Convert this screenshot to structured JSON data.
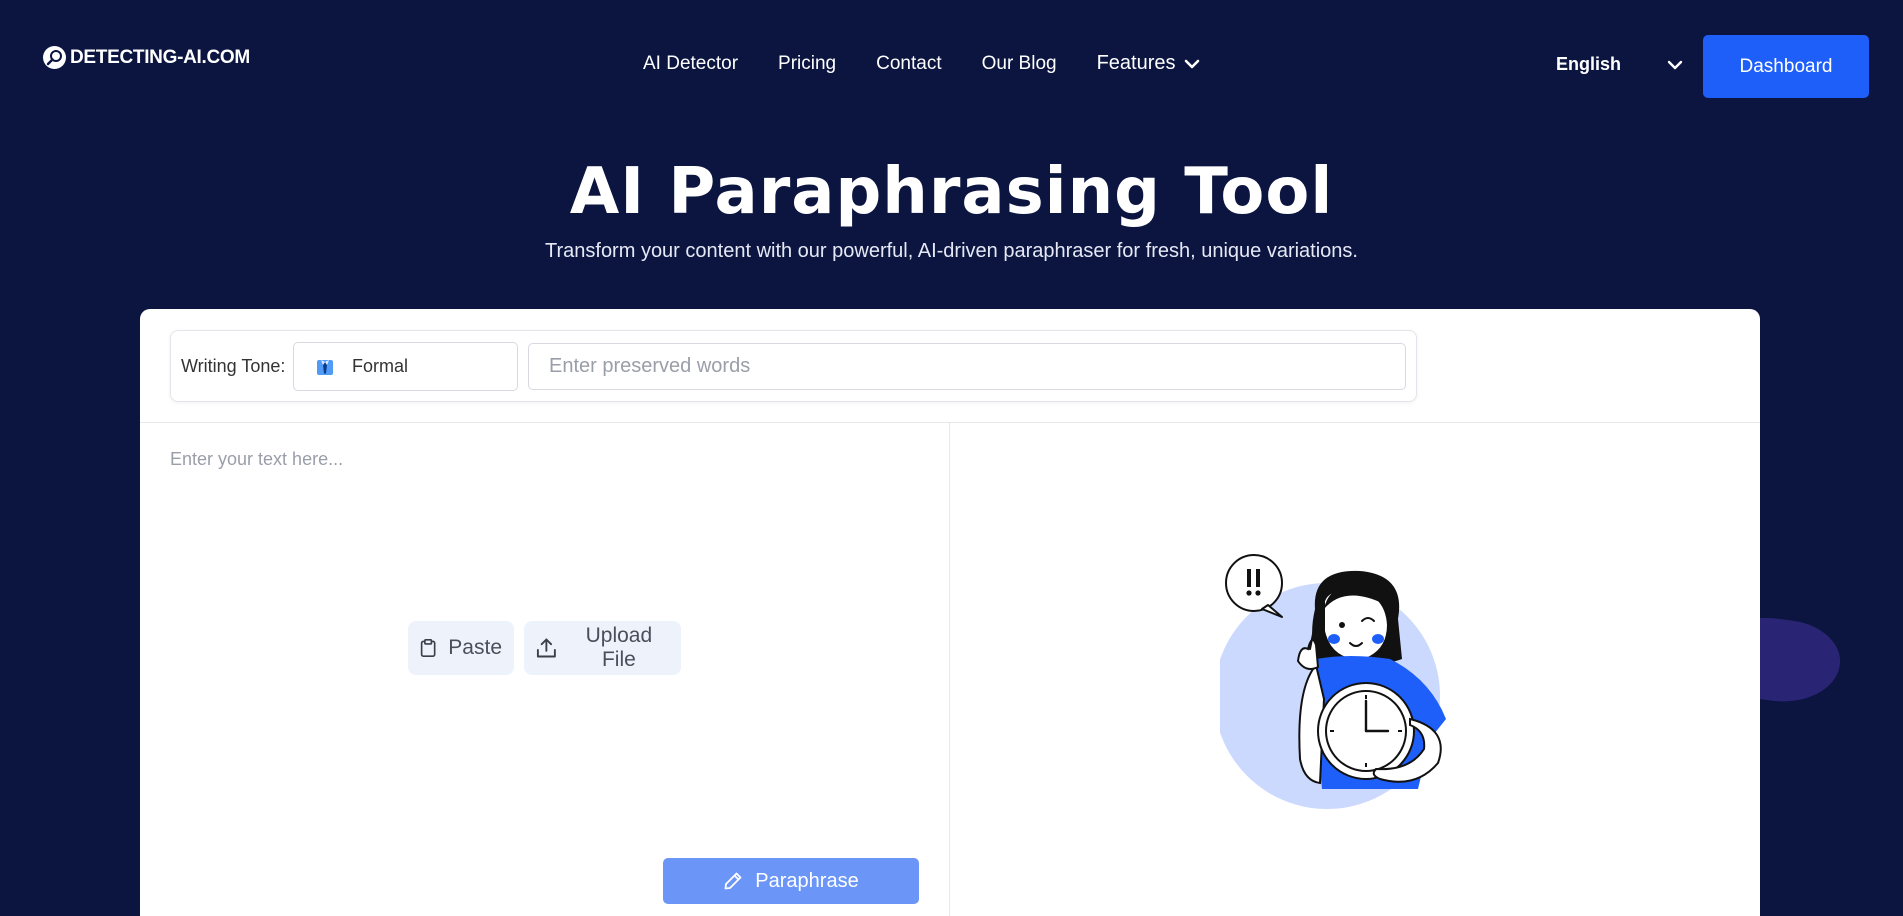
{
  "brand": {
    "name": "DETECTING-AI.COM"
  },
  "nav": {
    "items": [
      {
        "label": "AI Detector"
      },
      {
        "label": "Pricing"
      },
      {
        "label": "Contact"
      },
      {
        "label": "Our Blog"
      },
      {
        "label": "Features"
      }
    ]
  },
  "language": {
    "selected": "English"
  },
  "dashboard": {
    "label": "Dashboard"
  },
  "hero": {
    "title": "AI Paraphrasing Tool",
    "subtitle": "Transform your content with our powerful, AI-driven paraphraser for fresh, unique variations."
  },
  "toolbar": {
    "tone_label": "Writing Tone:",
    "tone_value": "Formal",
    "preserve_placeholder": "Enter preserved words"
  },
  "editor": {
    "placeholder": "Enter your text here...",
    "paste_label": "Paste",
    "upload_label": "Upload File",
    "paraphrase_label": "Paraphrase"
  },
  "colors": {
    "background": "#0b1540",
    "accent": "#1e5ffa",
    "paraphrase_button": "#6b95f7",
    "illustration_circle": "#ccd9ff"
  },
  "icons": {
    "logo": "magnifier-icon",
    "features_dropdown": "chevron-down-icon",
    "language_dropdown": "chevron-down-icon",
    "tone": "necktie-icon",
    "paste": "clipboard-icon",
    "upload": "upload-icon",
    "paraphrase": "pencil-icon"
  }
}
